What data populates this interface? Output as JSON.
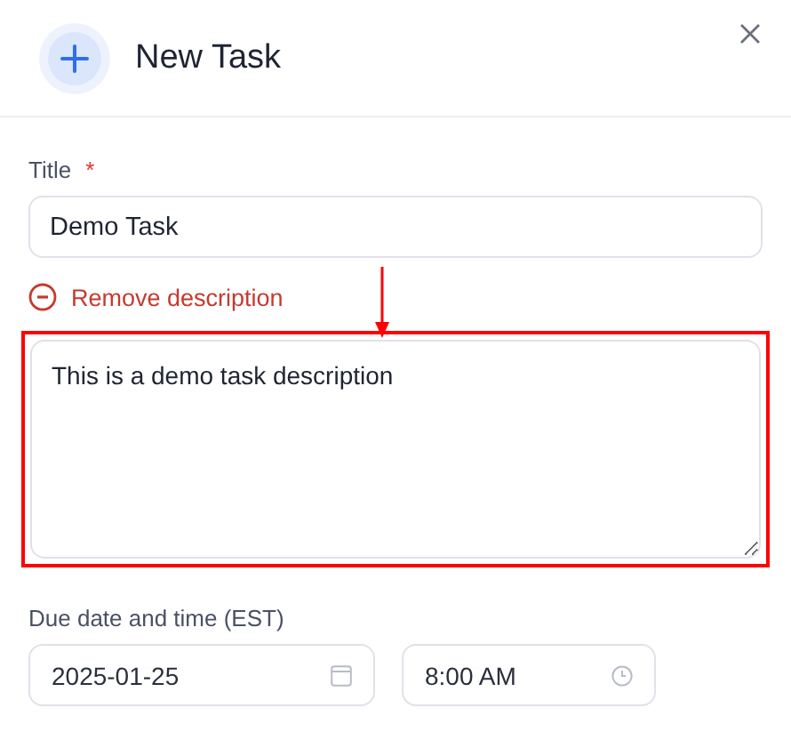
{
  "dialog": {
    "title": "New Task"
  },
  "title_field": {
    "label": "Title",
    "required_mark": "*",
    "value": "Demo Task"
  },
  "description": {
    "toggle_label": "Remove description",
    "value": "This is a demo task description",
    "highlighted": true
  },
  "due": {
    "label": "Due date and time (EST)",
    "date": "2025-01-25",
    "time": "8:00 AM"
  }
}
